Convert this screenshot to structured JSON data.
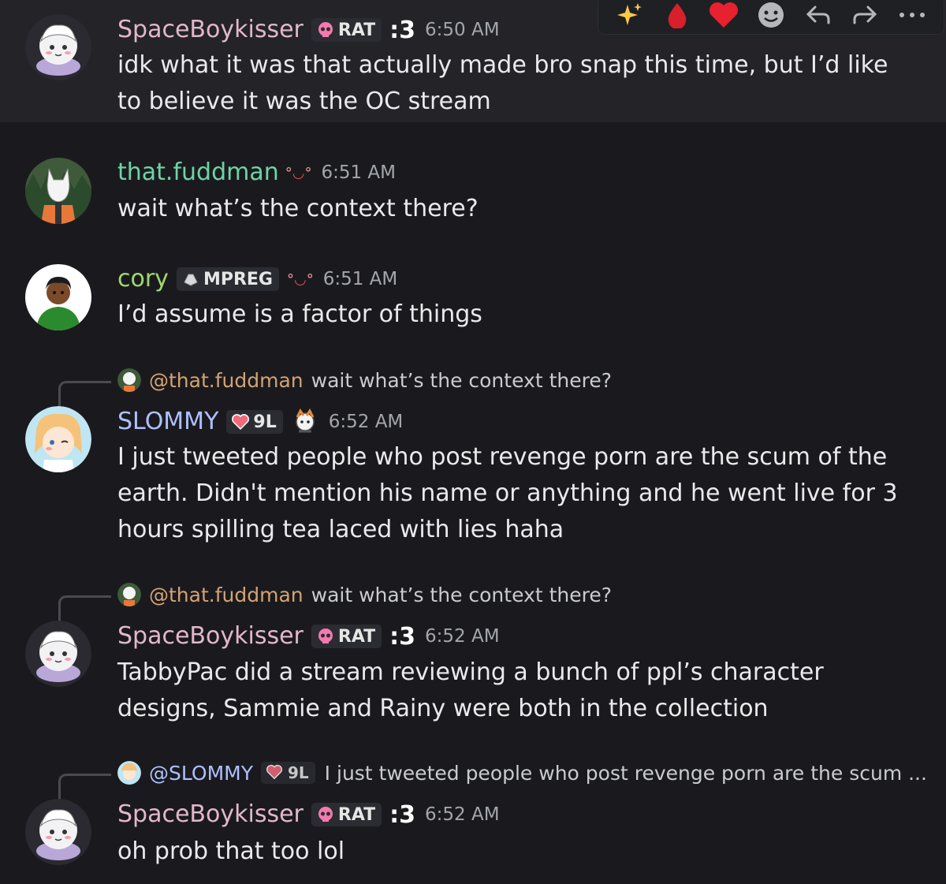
{
  "messages": [
    {
      "username": "SpaceBoykisser",
      "tag": "RAT",
      "badge": ":3",
      "time": "6:50 AM",
      "text": "idk what it was that actually made bro snap this time, but I’d like to believe it was the OC stream"
    },
    {
      "username": "that.fuddman",
      "time": "6:51 AM",
      "text": "wait what’s the context there?"
    },
    {
      "username": "cory",
      "tag": "MPREG",
      "time": "6:51 AM",
      "text": "I’d assume is a factor of things"
    },
    {
      "reply_name": "@that.fuddman",
      "reply_text": "wait what’s the context there?",
      "username": "SLOMMY",
      "tag": "9L",
      "time": "6:52 AM",
      "text": "I just tweeted people who post revenge porn are the scum of the earth. Didn't mention his name or anything and he went live for 3 hours spilling tea laced with lies haha"
    },
    {
      "reply_name": "@that.fuddman",
      "reply_text": "wait what’s the context there?",
      "username": "SpaceBoykisser",
      "tag": "RAT",
      "badge": ":3",
      "time": "6:52 AM",
      "text": "TabbyPac did a stream reviewing a bunch of ppl’s character designs, Sammie and Rainy were both in the collection"
    },
    {
      "reply_name": "@SLOMMY",
      "reply_tag": "9L",
      "reply_text": "I just tweeted people who post revenge porn are the scum ...",
      "username": "SpaceBoykisser",
      "tag": "RAT",
      "badge": ":3",
      "time": "6:52 AM",
      "text": "oh prob that too lol"
    }
  ],
  "toolbar_icons": [
    "sparkles-icon",
    "blood-drop-icon",
    "heart-icon",
    "emoji-icon",
    "reply-icon",
    "forward-icon",
    "more-icon"
  ],
  "colors": {
    "background": "#1a1a1e",
    "highlight": "#232328",
    "spaceboykisser": "#e2b8c8",
    "fuddman": "#6fd3a6",
    "cory": "#9fd86e",
    "slommy": "#aec0ff"
  }
}
